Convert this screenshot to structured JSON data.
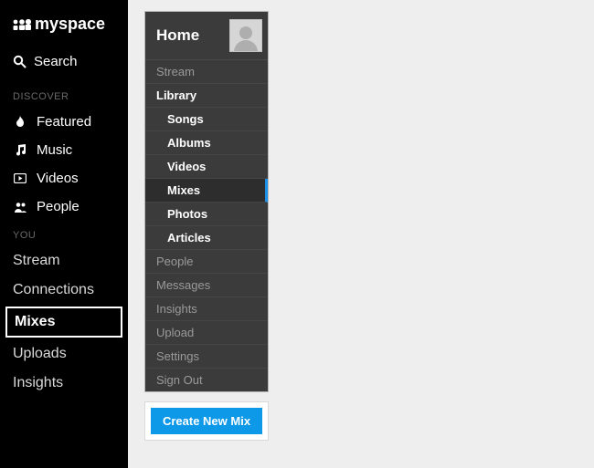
{
  "brand": {
    "name": "myspace"
  },
  "search": {
    "label": "Search"
  },
  "sections": {
    "discover": {
      "label": "DISCOVER",
      "items": {
        "featured": "Featured",
        "music": "Music",
        "videos": "Videos",
        "people": "People"
      }
    },
    "you": {
      "label": "YOU",
      "items": {
        "stream": "Stream",
        "connections": "Connections",
        "mixes": "Mixes",
        "uploads": "Uploads",
        "insights": "Insights"
      }
    }
  },
  "panel": {
    "title": "Home",
    "items": {
      "stream": "Stream",
      "library": "Library",
      "songs": "Songs",
      "albums": "Albums",
      "videos": "Videos",
      "mixes": "Mixes",
      "photos": "Photos",
      "articles": "Articles",
      "people": "People",
      "messages": "Messages",
      "insights": "Insights",
      "upload": "Upload",
      "settings": "Settings",
      "signout": "Sign Out"
    }
  },
  "actions": {
    "create_mix": "Create New Mix"
  }
}
